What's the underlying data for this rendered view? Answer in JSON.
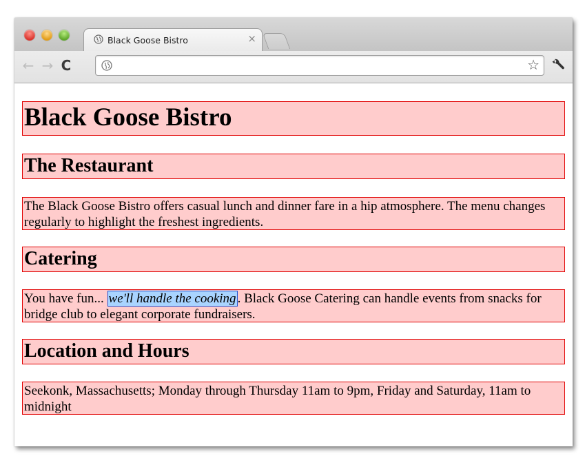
{
  "browser": {
    "tab_title": "Black Goose Bistro",
    "tab_close_glyph": "×",
    "back_glyph": "←",
    "forward_glyph": "→",
    "reload_glyph": "C",
    "address_value": "",
    "bookmark_glyph": "☆",
    "icons": [
      "page-globe-icon",
      "back-arrow-icon",
      "forward-arrow-icon",
      "reload-icon",
      "star-icon",
      "wrench-icon"
    ]
  },
  "page": {
    "title": "Black Goose Bistro",
    "sections": [
      {
        "heading": "The Restaurant",
        "text": "The Black Goose Bistro offers casual lunch and dinner fare in a hip atmosphere. The menu changes regularly to highlight the freshest ingredients."
      },
      {
        "heading": "Catering",
        "text_before": "You have fun... ",
        "emphasis": "we'll handle the cooking",
        "text_after": ". Black Goose Catering can handle events from snacks for bridge club to elegant corporate fundraisers."
      },
      {
        "heading": "Location and Hours",
        "text": "Seekonk, Massachusetts; Monday through Thursday 11am to 9pm, Friday and Saturday, 11am to midnight"
      }
    ]
  },
  "colors": {
    "block_fill": "#ffcccc",
    "block_border": "#e00000",
    "emphasis_fill": "#a9d4ff",
    "emphasis_border": "#2050d0"
  }
}
